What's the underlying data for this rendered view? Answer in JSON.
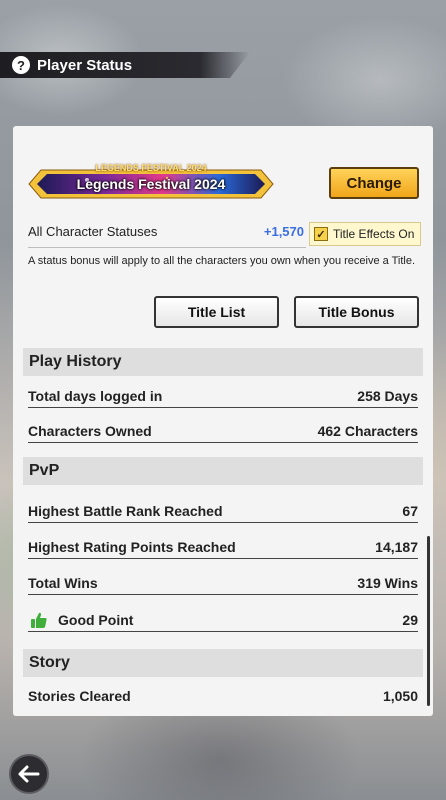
{
  "header": {
    "title": "Player Status",
    "help_icon": "question-icon"
  },
  "title_section": {
    "banner_top_text": "LEGENDS FESTIVAL 2024",
    "banner_text": "Legends Festival 2024",
    "change_label": "Change",
    "all_character_statuses_label": "All Character Statuses",
    "all_character_statuses_value": "+1,570",
    "title_effects_label": "Title Effects On",
    "title_effects_checked": true,
    "description": "A status bonus will apply to all the characters you own when you receive a Title.",
    "title_list_label": "Title List",
    "title_bonus_label": "Title Bonus"
  },
  "play_history": {
    "heading": "Play History",
    "rows": [
      {
        "label": "Total days logged in",
        "value": "258 Days"
      },
      {
        "label": "Characters Owned",
        "value": "462 Characters"
      }
    ]
  },
  "pvp": {
    "heading": "PvP",
    "rows": [
      {
        "label": "Highest Battle Rank Reached",
        "value": "67"
      },
      {
        "label": "Highest Rating Points Reached",
        "value": "14,187"
      },
      {
        "label": "Total Wins",
        "value": "319 Wins"
      },
      {
        "label": "Good Point",
        "value": "29"
      }
    ]
  },
  "story": {
    "heading": "Story",
    "rows": [
      {
        "label": "Stories Cleared",
        "value": "1,050"
      }
    ]
  },
  "colors": {
    "accent_gold": "#f0a51a",
    "value_blue": "#3b6ee0",
    "thumb_green": "#3fae3a"
  }
}
